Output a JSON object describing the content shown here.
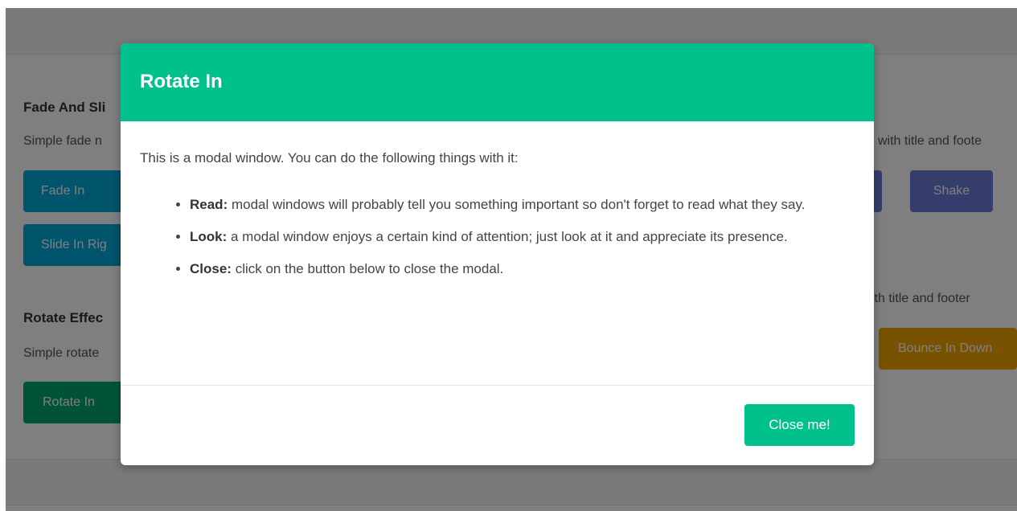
{
  "background": {
    "sections": {
      "fade_slide": {
        "title": "Fade And Sli",
        "description": "Simple fade n",
        "right_description": "with title and foote"
      },
      "rotate": {
        "title": "Rotate Effec",
        "description": "Simple rotate",
        "right_description": "ith title and footer"
      }
    },
    "buttons": {
      "fade_in": "Fade In",
      "slide_in_right": "Slide In Rig",
      "rotate_in": "Rotate In",
      "shake": "Shake",
      "bounce_in_down": "Bounce In Down"
    },
    "colors": {
      "fade_btn": "#00a8d6",
      "shake_btn": "#6b7bd9",
      "rotate_btn": "#00a86b",
      "bounce_btn": "#f0a500"
    }
  },
  "modal": {
    "title": "Rotate In",
    "intro": "This is a modal window. You can do the following things with it:",
    "items": [
      {
        "label": "Read:",
        "text": " modal windows will probably tell you something important so don't forget to read what they say."
      },
      {
        "label": "Look:",
        "text": " a modal window enjoys a certain kind of attention; just look at it and appreciate its presence."
      },
      {
        "label": "Close:",
        "text": " click on the button below to close the modal."
      }
    ],
    "close_button": "Close me!",
    "accent_color": "#00c08b"
  }
}
